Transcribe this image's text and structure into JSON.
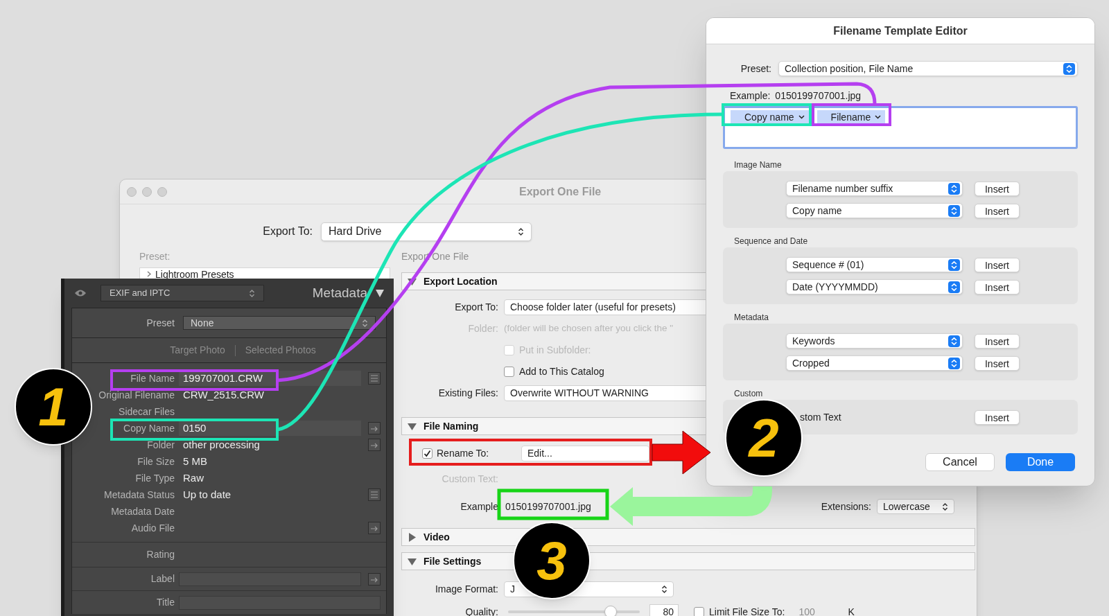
{
  "export_window": {
    "title": "Export One File",
    "export_to": {
      "label": "Export To:",
      "value": "Hard Drive"
    },
    "preset": {
      "label": "Preset:",
      "items": [
        "Lightroom Presets"
      ]
    },
    "breadcrumb": "Export One File",
    "sections": [
      {
        "kind": "location",
        "title": "Export Location",
        "expanded": true,
        "export_to": {
          "label": "Export To:",
          "value": "Choose folder later (useful for presets)"
        },
        "folder": {
          "label": "Folder:",
          "value": "(folder will be chosen after you click the \"",
          "disabled": true
        },
        "subfolder": {
          "label": "Put in Subfolder:",
          "checked": false,
          "disabled": true
        },
        "add_to_catalog": {
          "label": "Add to This Catalog",
          "checked": false,
          "disabled": false
        },
        "existing_files": {
          "label": "Existing Files:",
          "value": "Overwrite WITHOUT WARNING"
        }
      },
      {
        "kind": "naming",
        "title": "File Naming",
        "expanded": true,
        "rename": {
          "label": "Rename To:",
          "checked": true,
          "value": "Edit..."
        },
        "custom_text": {
          "label": "Custom Text:",
          "disabled": true
        },
        "example": {
          "label": "Example",
          "value": "0150199707001.jpg"
        },
        "extensions": {
          "label": "Extensions:",
          "value": "Lowercase"
        }
      },
      {
        "kind": "video",
        "title": "Video",
        "expanded": false
      },
      {
        "kind": "settings",
        "title": "File Settings",
        "expanded": true,
        "image_format": {
          "label": "Image Format:",
          "value": "J"
        },
        "quality": {
          "label": "Quality:",
          "level": 0.78,
          "value": "80"
        },
        "limit_size": {
          "label": "Limit File Size To:",
          "checked": false,
          "disabled": true,
          "value": "100",
          "unit": "K"
        }
      }
    ]
  },
  "metadata_panel": {
    "view": "EXIF and IPTC",
    "title": "Metadata",
    "preset": {
      "label": "Preset",
      "value": "None"
    },
    "tabs": [
      {
        "label": "Target Photo",
        "selected": false
      },
      {
        "label": "Selected Photos",
        "selected": false
      }
    ],
    "fields": [
      {
        "label": "File Name",
        "value": "199707001.CRW",
        "kind": "field",
        "button": {
          "kind": "list"
        }
      },
      {
        "label": "Original Filename",
        "value": "CRW_2515.CRW",
        "kind": "text"
      },
      {
        "label": "Sidecar Files",
        "kind": "text"
      },
      {
        "label": "Copy Name",
        "value": "0150",
        "kind": "field",
        "button": {
          "kind": "goto"
        }
      },
      {
        "label": "Folder",
        "value": "other processing",
        "kind": "text",
        "button": {
          "kind": "goto"
        }
      },
      {
        "label": "File Size",
        "value": "5 MB",
        "kind": "text"
      },
      {
        "label": "File Type",
        "value": "Raw",
        "kind": "text"
      },
      {
        "label": "Metadata Status",
        "value": "Up to date",
        "kind": "text",
        "button": {
          "kind": "list"
        }
      },
      {
        "label": "Metadata Date",
        "kind": "text"
      },
      {
        "label": "Audio File",
        "kind": "text",
        "button": {
          "kind": "goto"
        }
      }
    ],
    "rating": {
      "label": "Rating"
    },
    "label_field": {
      "label": "Label"
    },
    "title_field": {
      "label": "Title"
    }
  },
  "template_editor": {
    "title": "Filename Template Editor",
    "preset": {
      "label": "Preset:",
      "value": "Collection position, File Name"
    },
    "example": {
      "label": "Example:",
      "value": "0150199707001.jpg"
    },
    "tokens": [
      "Copy name",
      "Filename"
    ],
    "groups": [
      {
        "title": "Image Name",
        "rows": [
          {
            "kind": "select",
            "value": "Filename number suffix",
            "button": "Insert"
          },
          {
            "kind": "select",
            "value": "Copy name",
            "button": "Insert"
          }
        ]
      },
      {
        "title": "Sequence and Date",
        "rows": [
          {
            "kind": "select",
            "value": "Sequence # (01)",
            "button": "Insert"
          },
          {
            "kind": "select",
            "value": "Date (YYYYMMDD)",
            "button": "Insert"
          }
        ]
      },
      {
        "title": "Metadata",
        "rows": [
          {
            "kind": "select",
            "value": "Keywords",
            "button": "Insert"
          },
          {
            "kind": "select",
            "value": "Cropped",
            "button": "Insert"
          }
        ]
      },
      {
        "title": "Custom",
        "rows": [
          {
            "kind": "text",
            "value": "stom Text",
            "button": "Insert"
          }
        ]
      }
    ],
    "buttons": [
      {
        "label": "Cancel",
        "kind": "default"
      },
      {
        "label": "Done",
        "kind": "primary"
      }
    ]
  },
  "callouts": [
    {
      "number": "1"
    },
    {
      "number": "2"
    },
    {
      "number": "3"
    }
  ]
}
